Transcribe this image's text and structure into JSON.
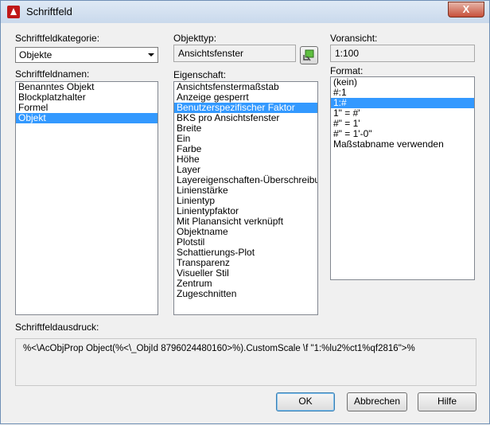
{
  "window": {
    "title": "Schriftfeld",
    "close_label": "X"
  },
  "category": {
    "label": "Schriftfeldkategorie:",
    "value": "Objekte"
  },
  "names": {
    "label": "Schriftfeldnamen:",
    "items": [
      "Benanntes Objekt",
      "Blockplatzhalter",
      "Formel",
      "Objekt"
    ],
    "selected_index": 3
  },
  "objtype": {
    "label": "Objekttyp:",
    "value": "Ansichtsfenster",
    "pick_icon": "select-object-icon"
  },
  "property": {
    "label": "Eigenschaft:",
    "items": [
      "Ansichtsfenstermaßstab",
      "Anzeige gesperrt",
      "Benutzerspezifischer Faktor",
      "BKS pro Ansichtsfenster",
      "Breite",
      "Ein",
      "Farbe",
      "Höhe",
      "Layer",
      "Layereigenschaften-Überschreibungen",
      "Linienstärke",
      "Linientyp",
      "Linientypfaktor",
      "Mit Planansicht verknüpft",
      "Objektname",
      "Plotstil",
      "Schattierungs-Plot",
      "Transparenz",
      "Visueller Stil",
      "Zentrum",
      "Zugeschnitten"
    ],
    "selected_index": 2
  },
  "preview": {
    "label": "Voransicht:",
    "value": "1:100"
  },
  "format": {
    "label": "Format:",
    "items": [
      "(kein)",
      "#:1",
      "1:#",
      "1\" = #'",
      "#\" = 1'",
      "#\" = 1'-0\"",
      "Maßstabname verwenden"
    ],
    "selected_index": 2
  },
  "expression": {
    "label": "Schriftfeldausdruck:",
    "value": "%<\\AcObjProp Object(%<\\_ObjId 8796024480160>%).CustomScale \\f \"1:%lu2%ct1%qf2816\">%"
  },
  "buttons": {
    "ok": "OK",
    "cancel": "Abbrechen",
    "help": "Hilfe"
  },
  "colors": {
    "selection": "#3399ff",
    "titlebar": "#c9d9ec",
    "close": "#c7503a"
  }
}
